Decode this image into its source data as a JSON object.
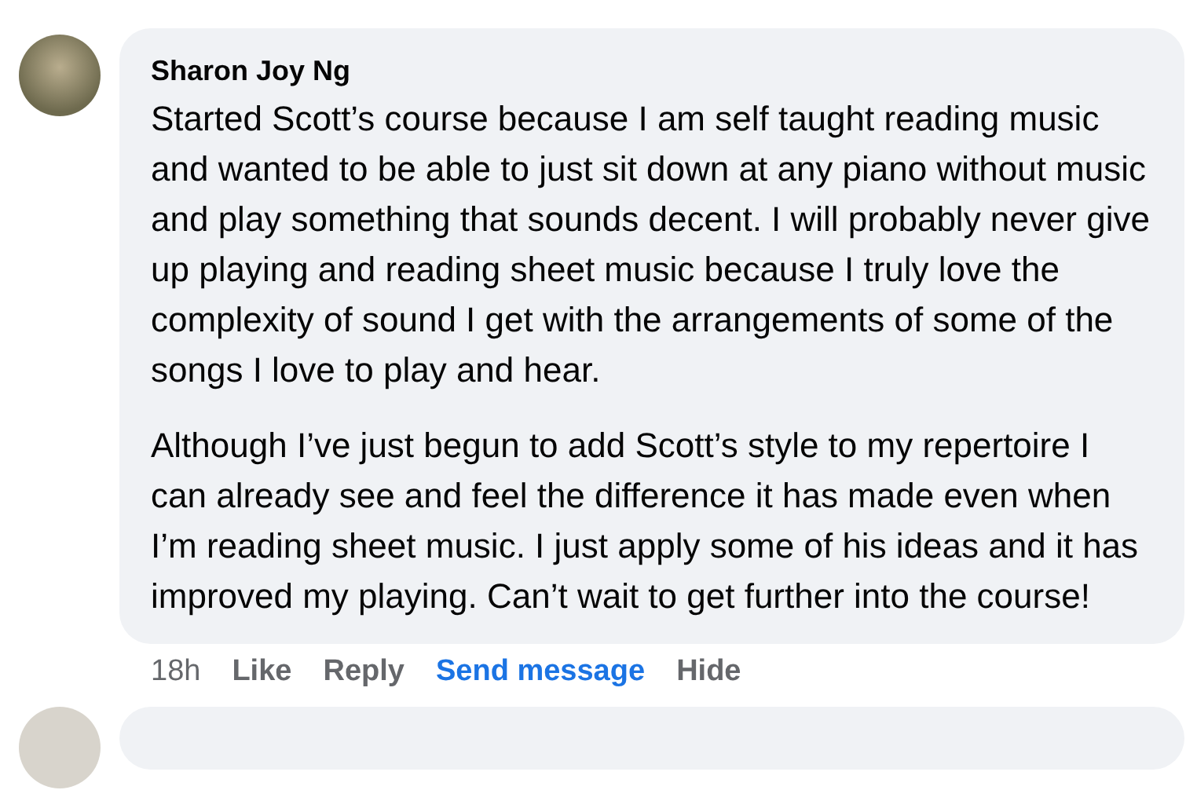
{
  "comment": {
    "author": "Sharon Joy Ng",
    "paragraphs": [
      "Started Scott’s course because I am self taught reading music and wanted to be able to just sit down at any piano without music and play something that sounds decent. I will probably never give up playing and reading sheet music because I truly love the complexity of sound I get with the arrangements of some of the songs I love to play and hear.",
      "Although I’ve just begun to add Scott’s style to my repertoire I can already see and feel the difference it has made even when I’m reading sheet music. I just apply some of his ideas and it has improved my playing. Can’t wait to get further into the course!"
    ],
    "time": "18h",
    "actions": [
      {
        "label": "Like",
        "kind": "plain"
      },
      {
        "label": "Reply",
        "kind": "plain"
      },
      {
        "label": "Send message",
        "kind": "link"
      },
      {
        "label": "Hide",
        "kind": "plain"
      }
    ]
  }
}
